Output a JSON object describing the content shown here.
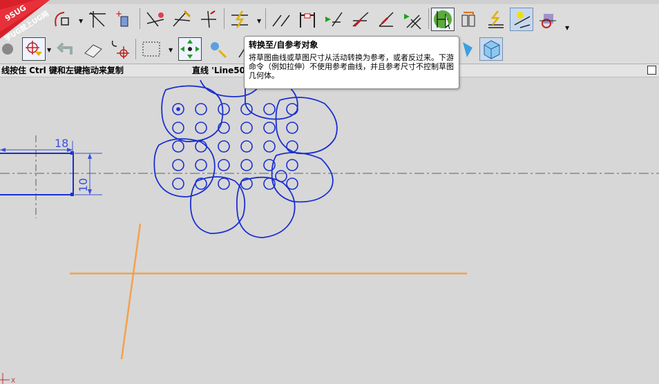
{
  "watermark": {
    "line1": "9SUG",
    "line2": "学UG就上UG网"
  },
  "status_bar": {
    "left_text": "线按住 Ctrl 键和左键拖动来复制",
    "right_text": "直线 'Line50"
  },
  "tooltip": {
    "title": "转换至/自参考对象",
    "body": "将草图曲线或草图尺寸从活动转换为参考，或者反过来。下游命令（例如拉伸）不使用参考曲线，并且参考尺寸不控制草图几何体。"
  },
  "toolbar_row1": [
    {
      "name": "profile-tool",
      "icon": "profile-icon"
    },
    {
      "name": "rectangle-tool",
      "icon": "rectangle-icon"
    },
    {
      "name": "offset-curve-tool",
      "icon": "offset-curve-icon"
    },
    {
      "name": "trim-corner-tool",
      "icon": "corner-icon"
    },
    {
      "name": "mirror-tool",
      "icon": "mirror-icon"
    },
    {
      "name": "quick-trim-tool",
      "icon": "quick-trim-icon"
    },
    {
      "name": "quick-extend-tool",
      "icon": "quick-extend-icon"
    },
    {
      "name": "make-corner-tool",
      "icon": "make-corner-icon"
    },
    {
      "name": "constraint-tool",
      "icon": "constraint-icon"
    },
    {
      "name": "fillet-tool",
      "icon": "fillet-icon"
    },
    {
      "name": "chamfer-tool",
      "icon": "chamfer-icon"
    },
    {
      "name": "perpendicular-tool",
      "icon": "perpendicular-icon"
    },
    {
      "name": "relations-tool",
      "icon": "relations-icon"
    },
    {
      "name": "parallel-tool",
      "icon": "parallel-icon"
    },
    {
      "name": "fixed-tool",
      "icon": "fixed-icon"
    },
    {
      "name": "convert-reference-tool",
      "icon": "convert-reference-icon"
    },
    {
      "name": "alternate-solution-tool",
      "icon": "alternate-solution-icon"
    },
    {
      "name": "inferred-constraints-tool",
      "icon": "inferred-constraints-icon"
    },
    {
      "name": "create-inferred-tool",
      "icon": "create-inferred-icon"
    },
    {
      "name": "auto-dimension-tool",
      "icon": "auto-dimension-icon"
    }
  ],
  "drawing": {
    "dim_width": "18",
    "dim_height": "10",
    "axis_label": "X"
  },
  "colors": {
    "sketch_blue": "#1a2fd0",
    "reference_orange": "#f5a04a",
    "centerline_gray": "#7a7a70",
    "dim_blue": "#3a50d8"
  }
}
